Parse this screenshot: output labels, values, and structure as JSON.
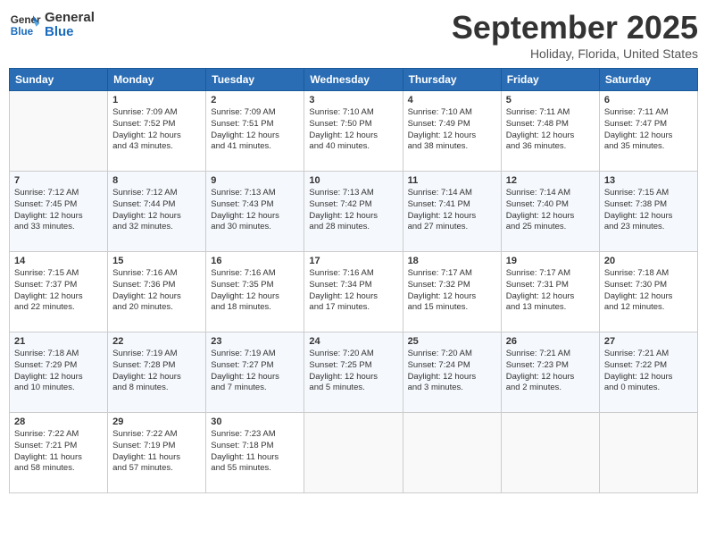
{
  "header": {
    "logo_line1": "General",
    "logo_line2": "Blue",
    "month": "September 2025",
    "location": "Holiday, Florida, United States"
  },
  "days_of_week": [
    "Sunday",
    "Monday",
    "Tuesday",
    "Wednesday",
    "Thursday",
    "Friday",
    "Saturday"
  ],
  "weeks": [
    [
      {
        "num": "",
        "info": ""
      },
      {
        "num": "1",
        "info": "Sunrise: 7:09 AM\nSunset: 7:52 PM\nDaylight: 12 hours\nand 43 minutes."
      },
      {
        "num": "2",
        "info": "Sunrise: 7:09 AM\nSunset: 7:51 PM\nDaylight: 12 hours\nand 41 minutes."
      },
      {
        "num": "3",
        "info": "Sunrise: 7:10 AM\nSunset: 7:50 PM\nDaylight: 12 hours\nand 40 minutes."
      },
      {
        "num": "4",
        "info": "Sunrise: 7:10 AM\nSunset: 7:49 PM\nDaylight: 12 hours\nand 38 minutes."
      },
      {
        "num": "5",
        "info": "Sunrise: 7:11 AM\nSunset: 7:48 PM\nDaylight: 12 hours\nand 36 minutes."
      },
      {
        "num": "6",
        "info": "Sunrise: 7:11 AM\nSunset: 7:47 PM\nDaylight: 12 hours\nand 35 minutes."
      }
    ],
    [
      {
        "num": "7",
        "info": "Sunrise: 7:12 AM\nSunset: 7:45 PM\nDaylight: 12 hours\nand 33 minutes."
      },
      {
        "num": "8",
        "info": "Sunrise: 7:12 AM\nSunset: 7:44 PM\nDaylight: 12 hours\nand 32 minutes."
      },
      {
        "num": "9",
        "info": "Sunrise: 7:13 AM\nSunset: 7:43 PM\nDaylight: 12 hours\nand 30 minutes."
      },
      {
        "num": "10",
        "info": "Sunrise: 7:13 AM\nSunset: 7:42 PM\nDaylight: 12 hours\nand 28 minutes."
      },
      {
        "num": "11",
        "info": "Sunrise: 7:14 AM\nSunset: 7:41 PM\nDaylight: 12 hours\nand 27 minutes."
      },
      {
        "num": "12",
        "info": "Sunrise: 7:14 AM\nSunset: 7:40 PM\nDaylight: 12 hours\nand 25 minutes."
      },
      {
        "num": "13",
        "info": "Sunrise: 7:15 AM\nSunset: 7:38 PM\nDaylight: 12 hours\nand 23 minutes."
      }
    ],
    [
      {
        "num": "14",
        "info": "Sunrise: 7:15 AM\nSunset: 7:37 PM\nDaylight: 12 hours\nand 22 minutes."
      },
      {
        "num": "15",
        "info": "Sunrise: 7:16 AM\nSunset: 7:36 PM\nDaylight: 12 hours\nand 20 minutes."
      },
      {
        "num": "16",
        "info": "Sunrise: 7:16 AM\nSunset: 7:35 PM\nDaylight: 12 hours\nand 18 minutes."
      },
      {
        "num": "17",
        "info": "Sunrise: 7:16 AM\nSunset: 7:34 PM\nDaylight: 12 hours\nand 17 minutes."
      },
      {
        "num": "18",
        "info": "Sunrise: 7:17 AM\nSunset: 7:32 PM\nDaylight: 12 hours\nand 15 minutes."
      },
      {
        "num": "19",
        "info": "Sunrise: 7:17 AM\nSunset: 7:31 PM\nDaylight: 12 hours\nand 13 minutes."
      },
      {
        "num": "20",
        "info": "Sunrise: 7:18 AM\nSunset: 7:30 PM\nDaylight: 12 hours\nand 12 minutes."
      }
    ],
    [
      {
        "num": "21",
        "info": "Sunrise: 7:18 AM\nSunset: 7:29 PM\nDaylight: 12 hours\nand 10 minutes."
      },
      {
        "num": "22",
        "info": "Sunrise: 7:19 AM\nSunset: 7:28 PM\nDaylight: 12 hours\nand 8 minutes."
      },
      {
        "num": "23",
        "info": "Sunrise: 7:19 AM\nSunset: 7:27 PM\nDaylight: 12 hours\nand 7 minutes."
      },
      {
        "num": "24",
        "info": "Sunrise: 7:20 AM\nSunset: 7:25 PM\nDaylight: 12 hours\nand 5 minutes."
      },
      {
        "num": "25",
        "info": "Sunrise: 7:20 AM\nSunset: 7:24 PM\nDaylight: 12 hours\nand 3 minutes."
      },
      {
        "num": "26",
        "info": "Sunrise: 7:21 AM\nSunset: 7:23 PM\nDaylight: 12 hours\nand 2 minutes."
      },
      {
        "num": "27",
        "info": "Sunrise: 7:21 AM\nSunset: 7:22 PM\nDaylight: 12 hours\nand 0 minutes."
      }
    ],
    [
      {
        "num": "28",
        "info": "Sunrise: 7:22 AM\nSunset: 7:21 PM\nDaylight: 11 hours\nand 58 minutes."
      },
      {
        "num": "29",
        "info": "Sunrise: 7:22 AM\nSunset: 7:19 PM\nDaylight: 11 hours\nand 57 minutes."
      },
      {
        "num": "30",
        "info": "Sunrise: 7:23 AM\nSunset: 7:18 PM\nDaylight: 11 hours\nand 55 minutes."
      },
      {
        "num": "",
        "info": ""
      },
      {
        "num": "",
        "info": ""
      },
      {
        "num": "",
        "info": ""
      },
      {
        "num": "",
        "info": ""
      }
    ]
  ]
}
